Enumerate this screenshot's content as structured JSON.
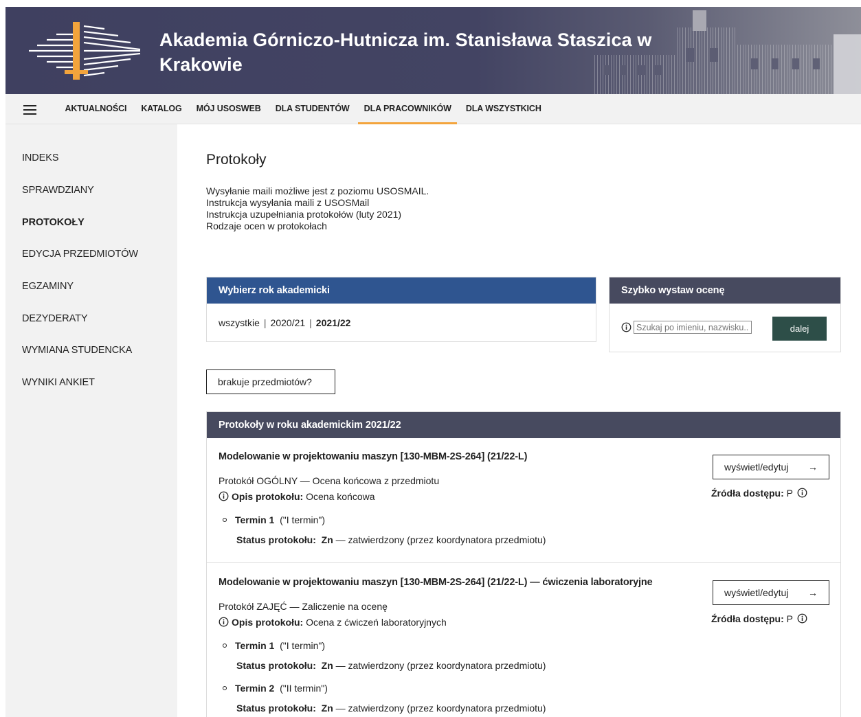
{
  "header": {
    "title_line1": "Akademia Górniczo-Hutnicza im. Stanisława Staszica w",
    "title_line2": "Krakowie"
  },
  "nav": {
    "items": [
      "AKTUALNOŚCI",
      "KATALOG",
      "MÓJ USOSWEB",
      "DLA STUDENTÓW",
      "DLA PRACOWNIKÓW",
      "DLA WSZYSTKICH"
    ],
    "active": "DLA PRACOWNIKÓW",
    "accent": "#f3a43c"
  },
  "sidebar": {
    "items": [
      "INDEKS",
      "SPRAWDZIANY",
      "PROTOKOŁY",
      "EDYCJA PRZEDMIOTÓW",
      "EGZAMINY",
      "DEZYDERATY",
      "WYMIANA STUDENCKA",
      "WYNIKI ANKIET"
    ],
    "active": "PROTOKOŁY"
  },
  "main": {
    "title": "Protokoły",
    "links": [
      "Wysyłanie maili możliwe jest z poziomu USOSMAIL.",
      "Instrukcja wysyłania maili z USOSMail",
      "Instrukcja uzupełniania protokołów (luty 2021)",
      "Rodzaje ocen w protokołach"
    ],
    "year_box": {
      "header": "Wybierz rok akademicki",
      "options": [
        "wszystkie",
        "2020/21",
        "2021/22"
      ],
      "selected": "2021/22",
      "header_color": "#2f5590"
    },
    "quick_box": {
      "header": "Szybko wystaw ocenę",
      "search_placeholder": "Szukaj po imieniu, nazwisku...",
      "button": "dalej",
      "button_color": "#2d4e48"
    },
    "missing_button": "brakuje przedmiotów?",
    "list": {
      "header": "Protokoły w roku akademickim 2021/22",
      "entries": [
        {
          "title": "Modelowanie w projektowaniu maszyn [130-MBM-2S-264] (21/22-L)",
          "type": "Protokół OGÓLNY — Ocena końcowa z przedmiotu",
          "opis_label": "Opis protokołu:",
          "opis_value": "Ocena końcowa",
          "terms": [
            {
              "name": "Termin 1",
              "desc": "(\"I termin\")",
              "status_label": "Status protokołu:",
              "status_code": "Zn",
              "status_text": "— zatwierdzony (przez koordynatora przedmiotu)"
            }
          ],
          "button": "wyświetl/edytuj",
          "sources_label": "Źródła dostępu:",
          "sources_value": "P"
        },
        {
          "title": "Modelowanie w projektowaniu maszyn [130-MBM-2S-264] (21/22-L) — ćwiczenia laboratoryjne",
          "type": "Protokół ZAJĘĆ — Zaliczenie na ocenę",
          "opis_label": "Opis protokołu:",
          "opis_value": "Ocena z ćwiczeń laboratoryjnych",
          "terms": [
            {
              "name": "Termin 1",
              "desc": "(\"I termin\")",
              "status_label": "Status protokołu:",
              "status_code": "Zn",
              "status_text": "— zatwierdzony (przez koordynatora przedmiotu)"
            },
            {
              "name": "Termin 2",
              "desc": "(\"II termin\")",
              "status_label": "Status protokołu:",
              "status_code": "Zn",
              "status_text": "— zatwierdzony (przez koordynatora przedmiotu)"
            }
          ],
          "button": "wyświetl/edytuj",
          "sources_label": "Źródła dostępu:",
          "sources_value": "P"
        }
      ]
    }
  },
  "icons": {
    "menu": "hamburger-icon",
    "info": "info-circle-icon",
    "arrow": "arrow-right-icon"
  }
}
